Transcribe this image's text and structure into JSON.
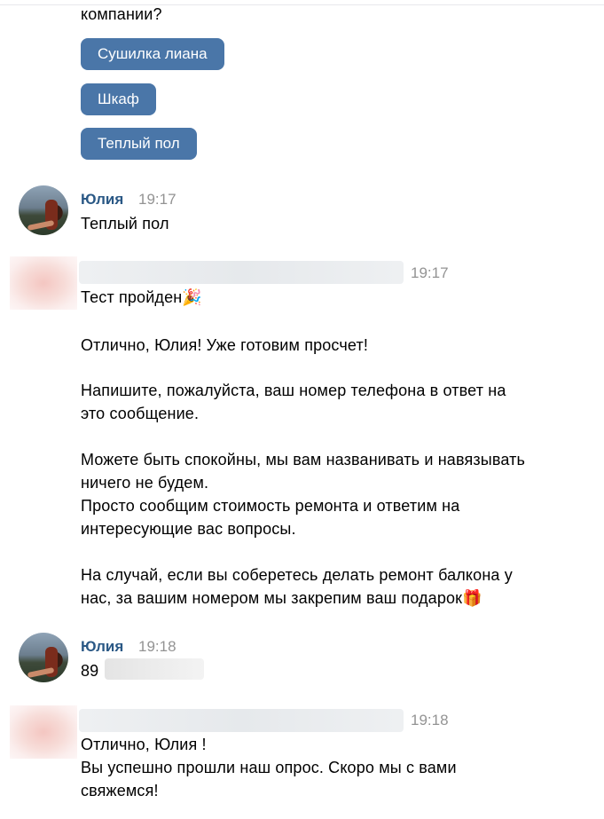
{
  "question_tail": "компании?",
  "keyboard_buttons": [
    "Сушилка лиана",
    "Шкаф",
    "Теплый пол"
  ],
  "messages": [
    {
      "author": "Юлия",
      "time": "19:17",
      "text": "Теплый пол"
    },
    {
      "author": "",
      "time": "19:17",
      "lines": [
        "Тест пройден🎉",
        "Отлично, Юлия! Уже готовим просчет!",
        "Напишите, пожалуйста, ваш номер телефона в ответ на",
        "это сообщение.",
        "Можете быть спокойны, мы вам названивать и навязывать",
        "ничего не будем.",
        "Просто сообщим стоимость ремонта и ответим на",
        "интересующие вас вопросы.",
        "На случай, если вы соберетесь делать ремонт балкона у",
        "нас, за вашим номером мы закрепим ваш подарок🎁"
      ]
    },
    {
      "author": "Юлия",
      "time": "19:18",
      "text": "89"
    },
    {
      "author": "",
      "time": "19:18",
      "lines": [
        "Отлично, Юлия !",
        "Вы успешно прошли наш опрос. Скоро мы с вами",
        "свяжемся!"
      ]
    }
  ],
  "colors": {
    "button_bg": "#4a76a8",
    "name": "#2a5885",
    "time": "#939393"
  }
}
